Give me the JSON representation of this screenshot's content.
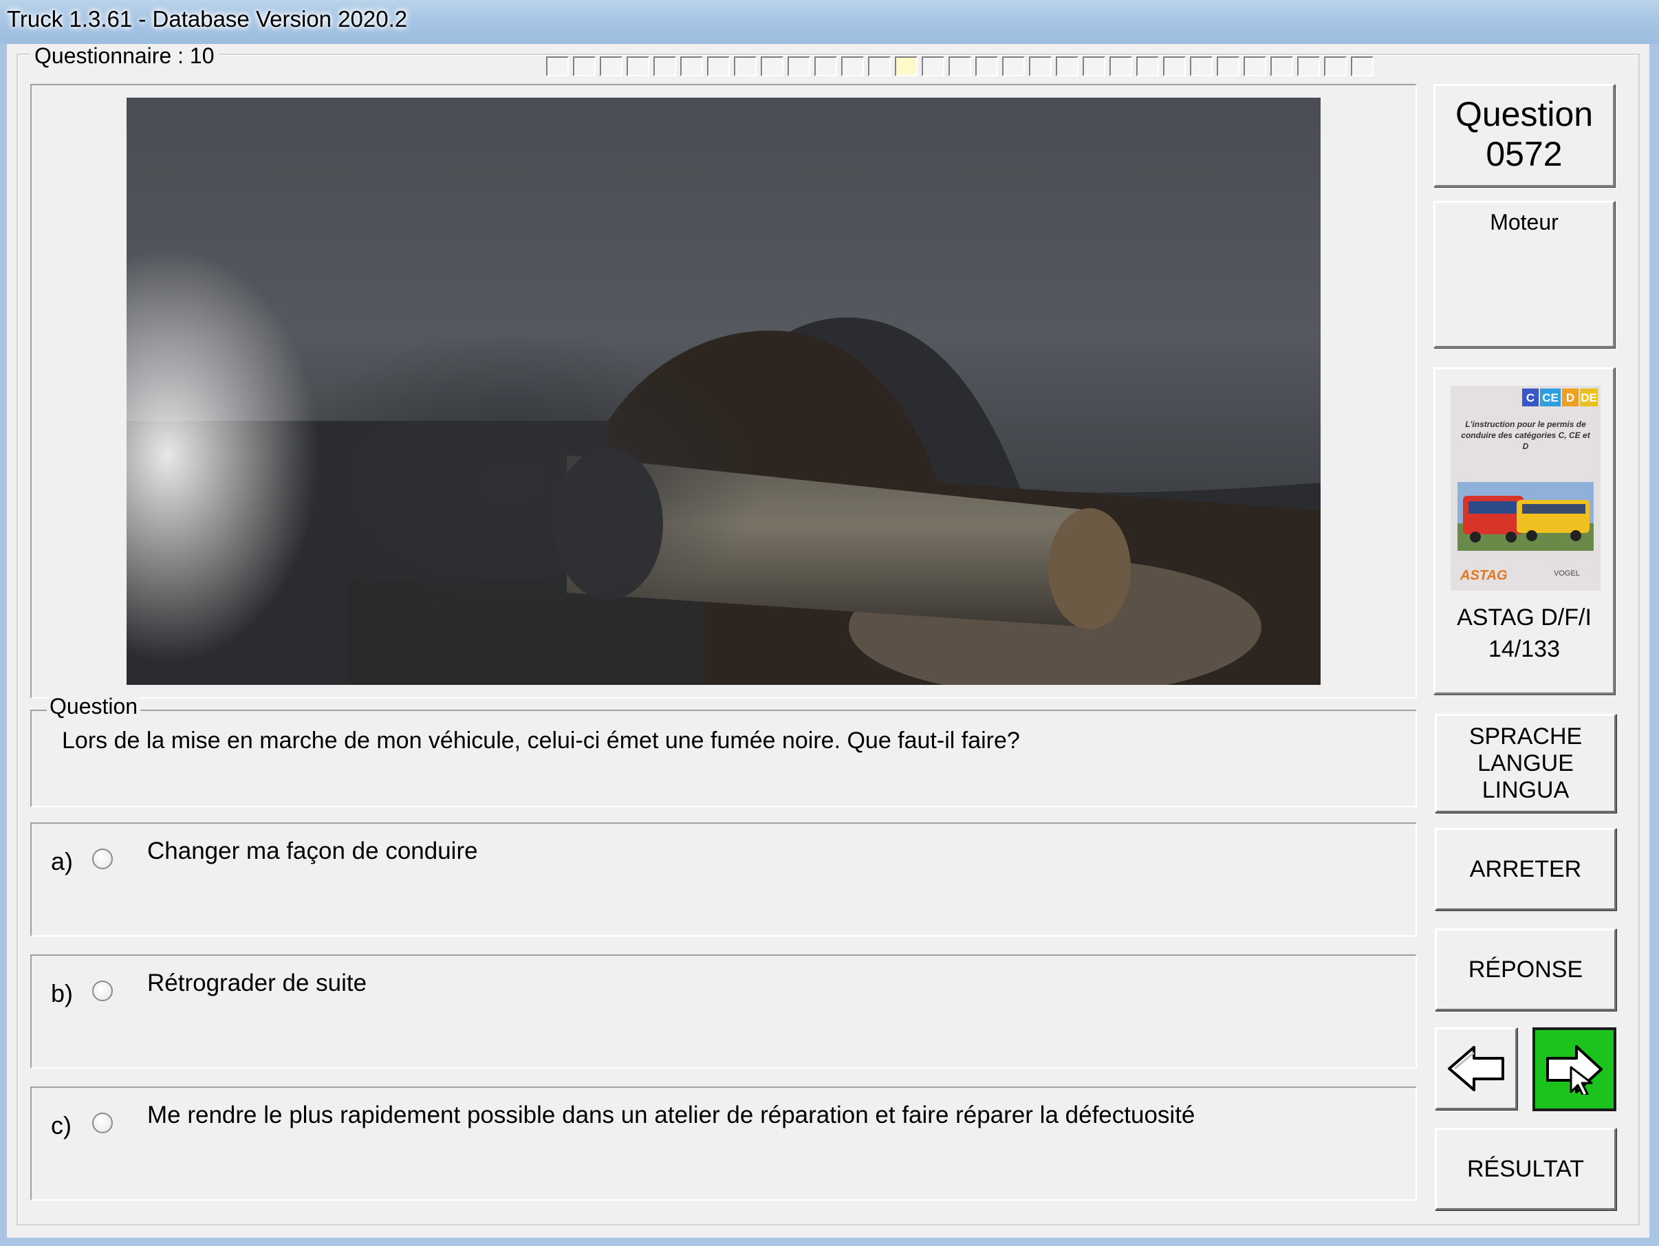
{
  "window": {
    "title": "Truck 1.3.61 - Database Version 2020.2"
  },
  "questionnaire": {
    "label": "Questionnaire : 10",
    "progress": {
      "total_cells": 31,
      "current_index": 13
    }
  },
  "image": {
    "icon": "exhaust-pipe-photo"
  },
  "question": {
    "legend": "Question",
    "text": "Lors de la mise en marche de mon véhicule, celui-ci émet une fumée noire. Que faut-il faire?"
  },
  "answers": [
    {
      "letter": "a)",
      "text": "Changer ma façon de conduire"
    },
    {
      "letter": "b)",
      "text": "Rétrograder de suite"
    },
    {
      "letter": "c)",
      "text": "Me rendre le plus rapidement possible dans un atelier de réparation et faire réparer la défectuosité"
    }
  ],
  "sidebar": {
    "question_word": "Question",
    "question_number": "0572",
    "category": "Moteur",
    "book": {
      "badges": [
        "C",
        "CE",
        "D",
        "DE"
      ],
      "cover_text": "L'instruction pour le permis de conduire des catégories C, CE et D",
      "logo_left": "ASTAG",
      "logo_right": "VOGEL",
      "title": "ASTAG D/F/I",
      "page": "14/133"
    }
  },
  "buttons": {
    "language": [
      "SPRACHE",
      "LANGUE",
      "LINGUA"
    ],
    "stop": "ARRETER",
    "answer": "RÉPONSE",
    "result": "RÉSULTAT",
    "prev_icon": "arrow-left-icon",
    "next_icon": "arrow-right-icon"
  },
  "colors": {
    "next_button": "#1cc31c",
    "current_progress_cell": "#fff8c8"
  }
}
